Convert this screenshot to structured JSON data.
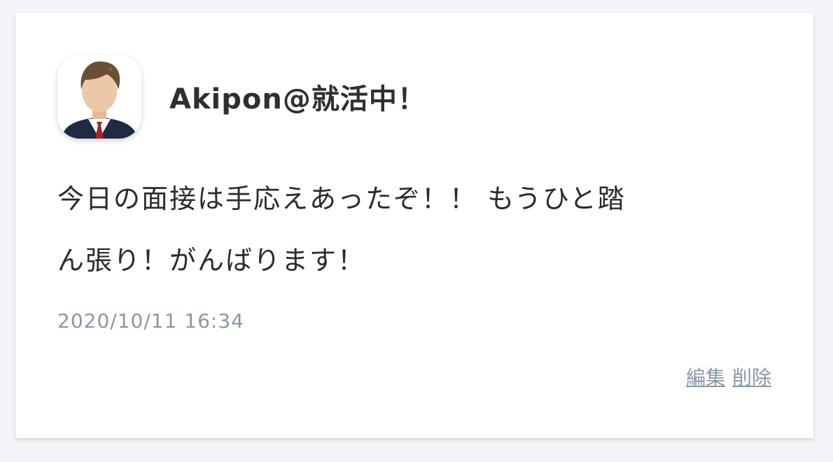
{
  "post": {
    "author_name": "Akipon@就活中！",
    "avatar_icon": "businessman-avatar-icon",
    "body_line_1": "今日の面接は手応えあったぞ！！ もうひと踏",
    "body_line_2": "ん張り！がんばります！",
    "timestamp": "2020/10/11 16:34",
    "edit_label": "編集",
    "delete_label": "削除"
  },
  "colors": {
    "background": "#f3f5f8",
    "card": "#ffffff",
    "text": "#2b2b2b",
    "muted": "#8a97a5",
    "suit": "#1f2a44",
    "tie": "#a3242b",
    "hair": "#6b4f35",
    "skin": "#ecc9a6"
  }
}
